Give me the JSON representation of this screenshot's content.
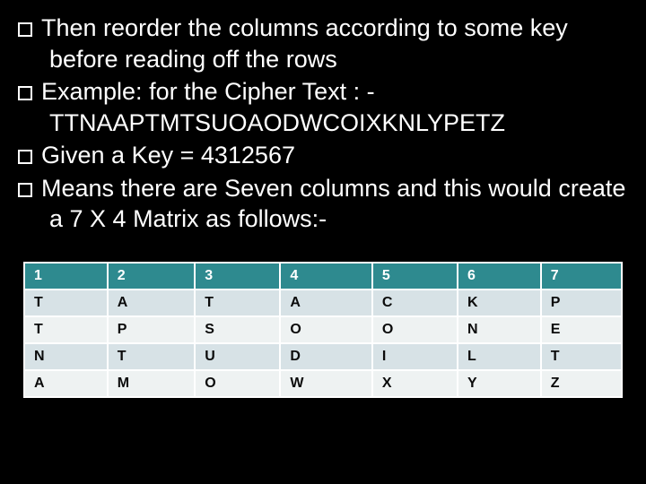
{
  "bullets": [
    {
      "first": "Then",
      "rest": " reorder the columns according to some key before reading off the rows"
    },
    {
      "first": "Example:",
      "rest": " for the Cipher Text : - TTNAAPTMTSUOAODWCOIXKNLYPETZ"
    },
    {
      "first": "Given",
      "rest": " a Key = 4312567"
    },
    {
      "first": "Means",
      "rest": " there are Seven columns and this would create a 7 X 4 Matrix as follows:-"
    }
  ],
  "chart_data": {
    "type": "table",
    "headers": [
      "1",
      "2",
      "3",
      "4",
      "5",
      "6",
      "7"
    ],
    "rows": [
      [
        "T",
        "A",
        "T",
        "A",
        "C",
        "K",
        "P"
      ],
      [
        "T",
        "P",
        "S",
        "O",
        "O",
        "N",
        "E"
      ],
      [
        "N",
        "T",
        "U",
        "D",
        "I",
        "L",
        "T"
      ],
      [
        "A",
        "M",
        "O",
        "W",
        "X",
        "Y",
        "Z"
      ]
    ]
  }
}
